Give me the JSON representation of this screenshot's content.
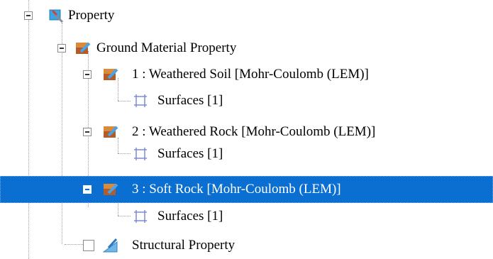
{
  "tree": {
    "root": {
      "label": "Property",
      "icon": "property-icon"
    },
    "ground": {
      "label": "Ground Material Property",
      "icon": "ground-material-icon"
    },
    "materials": [
      {
        "label": "1 : Weathered Soil [Mohr-Coulomb (LEM)]",
        "icon": "material-icon",
        "child": "Surfaces [1]"
      },
      {
        "label": "2 : Weathered Rock [Mohr-Coulomb (LEM)]",
        "icon": "material-icon",
        "child": "Surfaces [1]"
      },
      {
        "label": "3 : Soft Rock [Mohr-Coulomb (LEM)]",
        "icon": "material-icon",
        "child": "Surfaces [1]",
        "selected": true
      }
    ],
    "structural": {
      "label": "Structural Property",
      "icon": "structural-icon"
    },
    "colors": {
      "selection": "#0a6fd1",
      "connector": "#9a9a9a"
    }
  }
}
